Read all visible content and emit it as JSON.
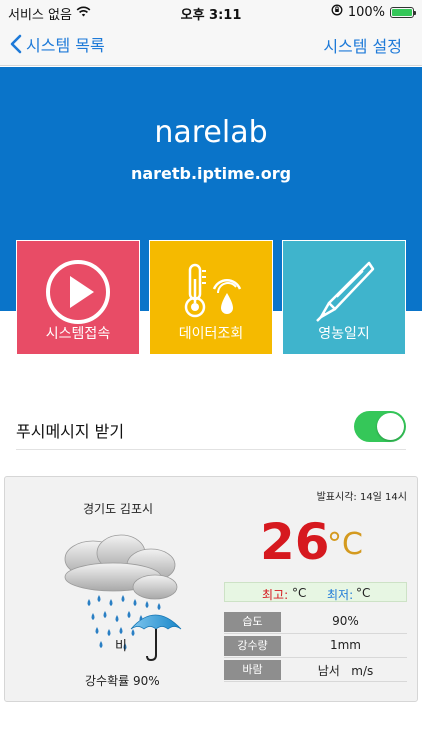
{
  "status_bar": {
    "carrier": "서비스 없음",
    "time": "오후 3:11",
    "battery": "100%"
  },
  "nav": {
    "back_label": "시스템 목록",
    "right_label": "시스템 설정"
  },
  "header": {
    "title": "narelab",
    "url": "naretb.iptime.org",
    "background": "#0a74c9"
  },
  "tiles": [
    {
      "label": "시스템접속",
      "icon": "play-icon",
      "color": "#e84c66"
    },
    {
      "label": "데이터조회",
      "icon": "thermometer-icon",
      "color": "#f5ba00"
    },
    {
      "label": "영농일지",
      "icon": "pen-icon",
      "color": "#3fb4cc"
    }
  ],
  "push": {
    "label": "푸시메시지 받기",
    "enabled": true
  },
  "weather": {
    "location": "경기도 김포시",
    "announce_time": "발표시각: 14일 14시",
    "condition": "비",
    "condition_icon": "rain-umbrella-icon",
    "precip_probability": "강수확률 90%",
    "temperature": "26",
    "temperature_unit": "°C",
    "high_label": "최고:",
    "high_value": "°C",
    "low_label": "최저:",
    "low_value": "°C",
    "rows": [
      {
        "key": "습도",
        "value": "90%"
      },
      {
        "key": "강수량",
        "value": "1mm"
      },
      {
        "key": "바람",
        "value": "남서   m/s"
      }
    ]
  }
}
